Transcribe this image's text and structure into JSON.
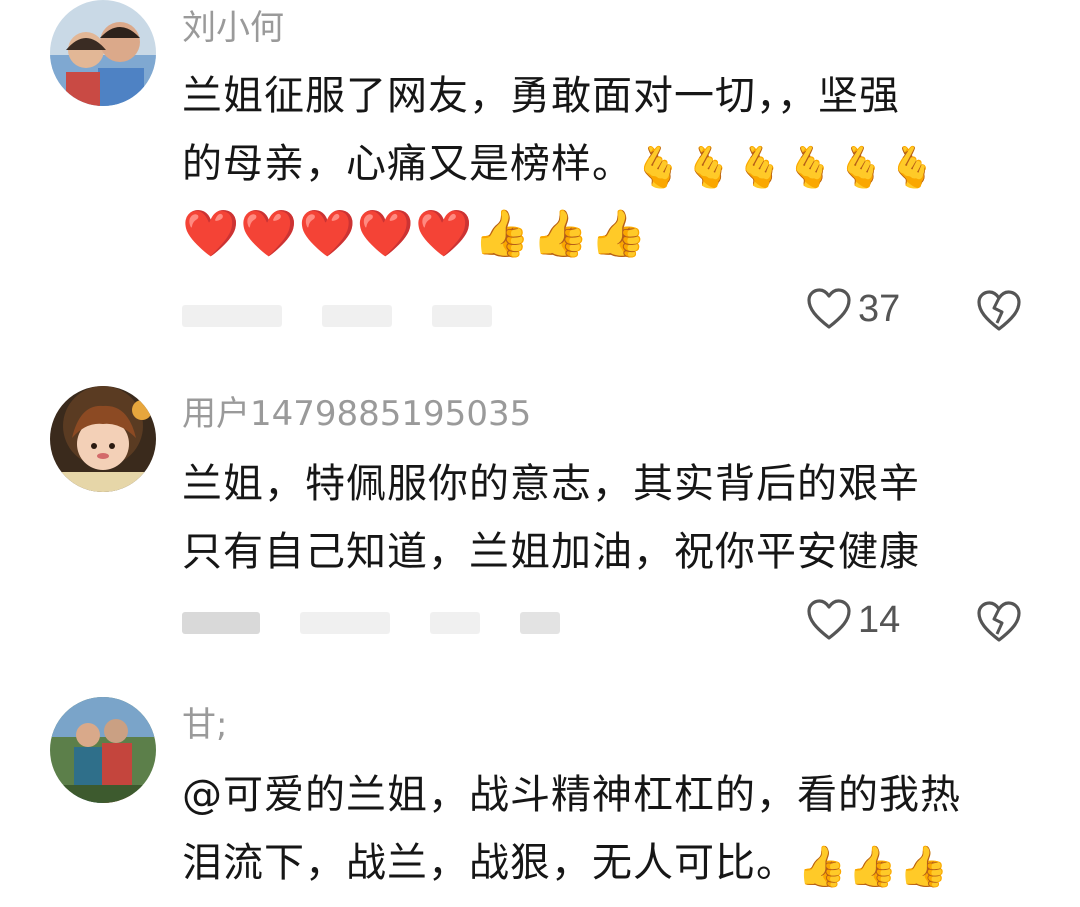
{
  "comments": [
    {
      "username": "刘小何",
      "line1": "兰姐征服了网友，勇敢面对一切，，坚强",
      "line2": "的母亲，心痛又是榜样。",
      "line2_emoji": "🫰🫰🫰🫰🫰🫰",
      "line3_emoji": "❤️❤️❤️❤️❤️👍👍👍",
      "likes": "37"
    },
    {
      "username": "用户1479885195035",
      "line1": "兰姐，特佩服你的意志，其实背后的艰辛",
      "line2": "只有自己知道，兰姐加油，祝你平安健康",
      "likes": "14"
    },
    {
      "username": "甘;",
      "line1": "@可爱的兰姐，战斗精神杠杠的，看的我热",
      "line2": "泪流下，战兰，战狠，无人可比。",
      "line2_emoji": "👍👍👍"
    }
  ],
  "icons": {
    "like": "heart-outline-icon",
    "dislike": "broken-heart-icon"
  },
  "colors": {
    "username": "#9a9a9a",
    "text": "#161616",
    "icon": "#555555"
  }
}
